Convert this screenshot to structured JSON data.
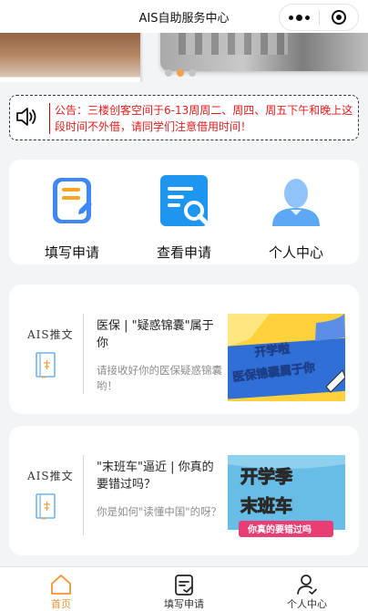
{
  "window": {
    "title": "AIS自助服务中心"
  },
  "banner": {
    "slide_count": 3,
    "active_slide": 2
  },
  "notice": {
    "text": "公告：三楼创客空间于6-13周周二、周四、周五下午和晚上这段时间不外借，请同学们注意借用时间！",
    "color": "#e21d1d"
  },
  "functions": [
    {
      "label": "填写申请",
      "icon": "fill-form-icon"
    },
    {
      "label": "查看申请",
      "icon": "view-application-icon"
    },
    {
      "label": "个人中心",
      "icon": "personal-center-icon"
    }
  ],
  "articles": [
    {
      "brand": "AIS推文",
      "title": "医保 | \"疑惑锦囊\"属于你",
      "desc": "请接收好你的医保疑惑锦囊哟！",
      "image_text": [
        "开学啦",
        "医保锦囊属于你"
      ]
    },
    {
      "brand": "AIS推文",
      "title": "\"末班车\"逼近 | 你真的要错过吗？",
      "desc": "你是如何\"读懂中国\"的呀？",
      "image_text": [
        "开学季",
        "末班车",
        "你真的要错过吗"
      ]
    }
  ],
  "tabbar": {
    "items": [
      {
        "label": "首页",
        "icon": "home-icon",
        "active": true
      },
      {
        "label": "填写申请",
        "icon": "edit-form-icon",
        "active": false
      },
      {
        "label": "个人中心",
        "icon": "user-icon",
        "active": false
      }
    ],
    "active_color": "#f39233"
  }
}
